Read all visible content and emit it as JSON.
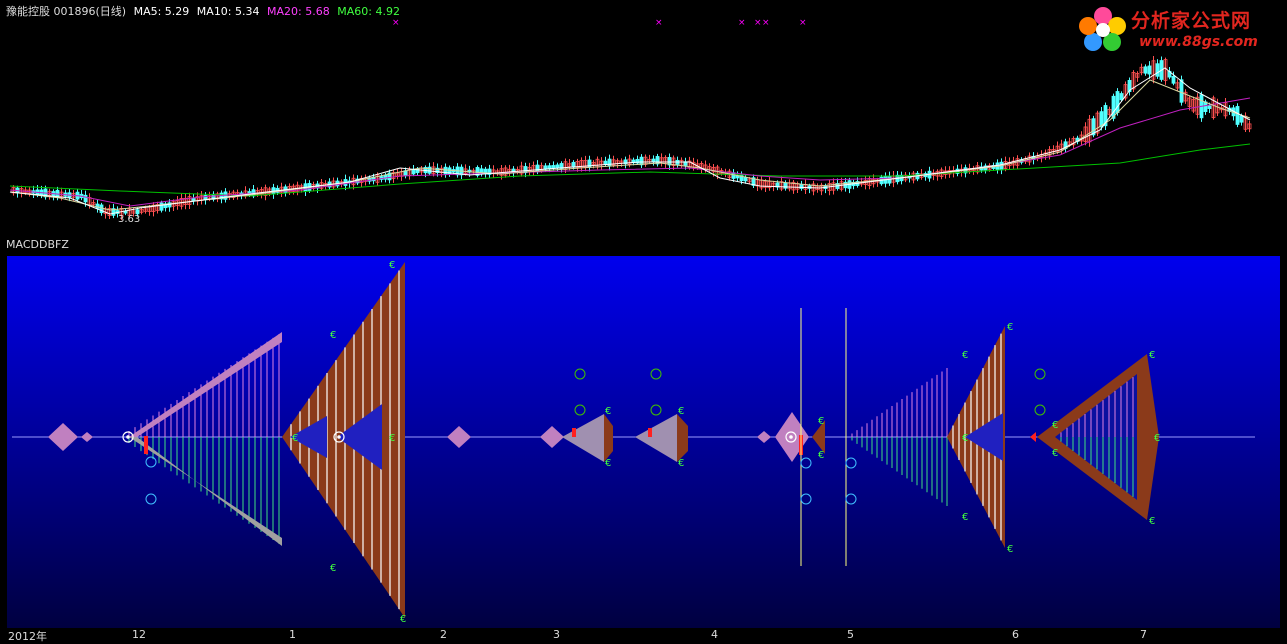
{
  "header": {
    "stock": "豫能控股 001896(日线)",
    "ma5": "MA5: 5.29",
    "ma10": "MA10: 5.34",
    "ma20": "MA20: 5.68",
    "ma60": "MA60: 4.92"
  },
  "colors": {
    "ma5": "#ffffff",
    "ma10": "#ffff00",
    "ma20": "#ff00ff",
    "ma60": "#00ff00",
    "panel_top": "#0000ee",
    "triangle_fill": "#8b3a1a",
    "lilac": "#c080c0"
  },
  "logo": {
    "title": "分析家公式网",
    "url": "www.88gs.com"
  },
  "price_chart": {
    "low_label": "3.63"
  },
  "indicator": {
    "name": "MACDDBFZ"
  },
  "x_axis": {
    "labels": [
      "2012年",
      "12",
      "1",
      "2",
      "3",
      "4",
      "5",
      "6",
      "7"
    ]
  }
}
